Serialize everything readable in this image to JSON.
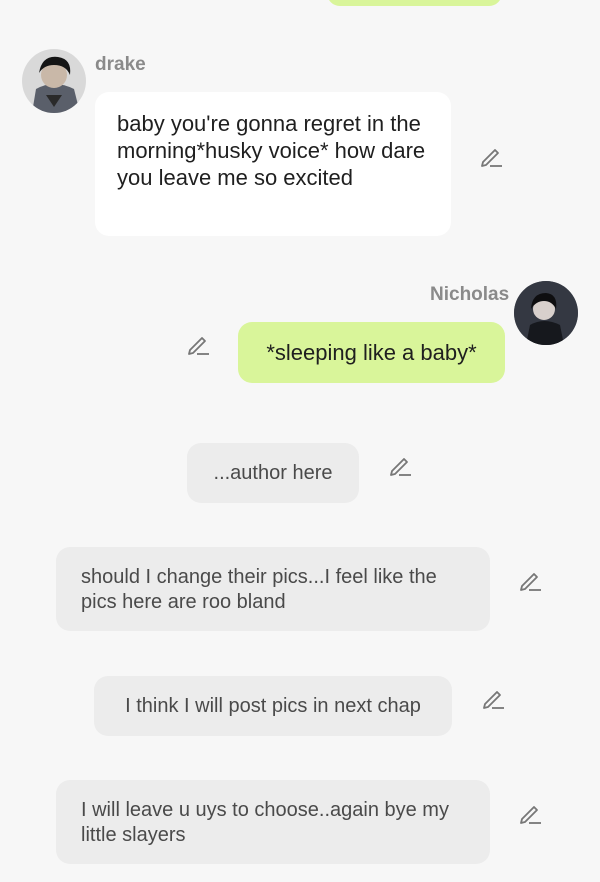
{
  "colors": {
    "background": "#f7f7f7",
    "incoming_bubble": "#ffffff",
    "outgoing_bubble": "#d9f59a",
    "narration_bubble": "#ececec",
    "name_text": "#8a8a8a"
  },
  "messages": [
    {
      "type": "incoming",
      "sender": "drake",
      "avatar_icon": "drake-avatar",
      "text": "baby you're gonna regret in the morning*husky voice* how dare you leave me so excited"
    },
    {
      "type": "outgoing",
      "sender": "Nicholas",
      "avatar_icon": "nicholas-avatar",
      "text": "*sleeping like a baby*"
    },
    {
      "type": "narration",
      "text": "...author here"
    },
    {
      "type": "narration",
      "text": "should I change their pics...I feel like the pics here are roo bland"
    },
    {
      "type": "narration",
      "text": "I think I will post pics in next chap"
    },
    {
      "type": "narration",
      "text": "I will leave u uys to choose..again bye my little slayers"
    }
  ],
  "icons": {
    "edit": "pencil-icon"
  }
}
